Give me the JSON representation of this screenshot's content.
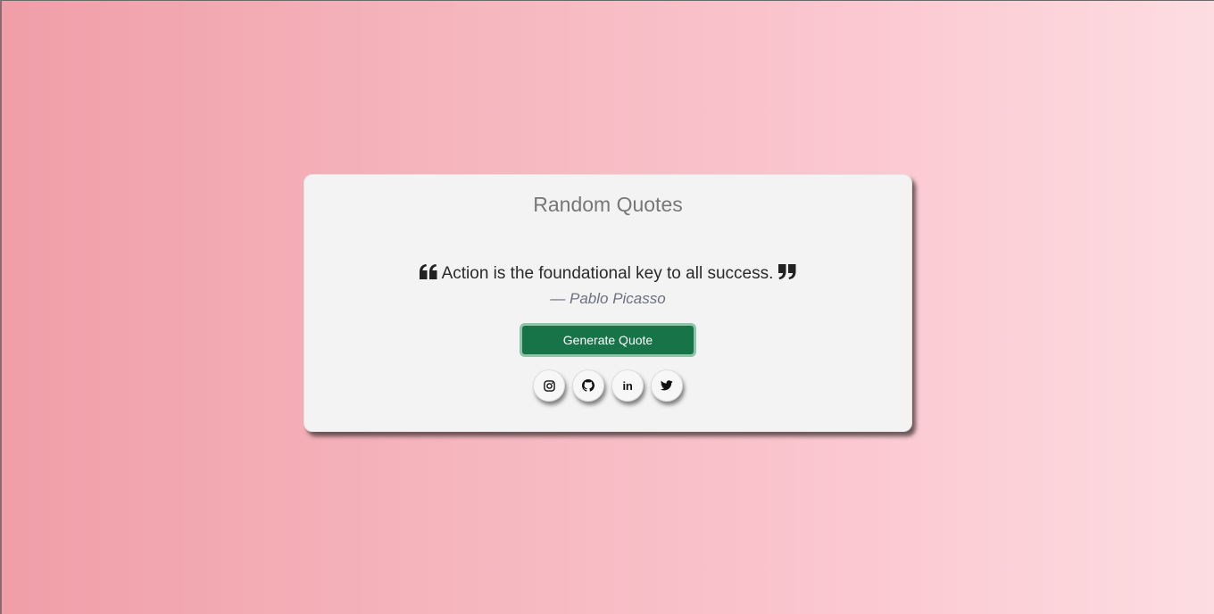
{
  "card": {
    "title": "Random Quotes",
    "quote_text": "Action is the foundational key to all success.",
    "author": "— Pablo Picasso",
    "generate_button_label": "Generate Quote"
  },
  "icons": {
    "open_quote": "quote-left-icon",
    "close_quote": "quote-right-icon",
    "instagram": "instagram-icon",
    "github": "github-icon",
    "linkedin": "linkedin-icon",
    "twitter": "twitter-icon"
  },
  "social_links": {
    "linkedin_label": "in"
  },
  "colors": {
    "background_gradient_start": "#f09ea8",
    "background_gradient_end": "#fddde1",
    "card_background": "#f3f3f3",
    "button_background": "#177448",
    "button_border": "#8fc4a6",
    "title_color": "#777777"
  }
}
